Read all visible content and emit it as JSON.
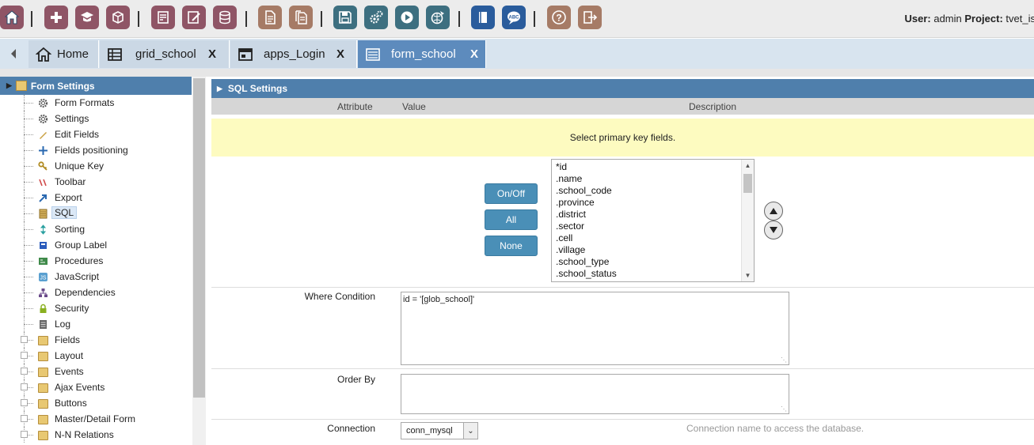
{
  "toolbar": {
    "user_label": "User:",
    "user_value": "admin",
    "project_label": "Project:",
    "project_value": "tvet_is",
    "icons": [
      "home-icon",
      "add-icon",
      "publish-icon",
      "cube-icon",
      "new-form-icon",
      "edit-form-icon",
      "database-icon",
      "document-icon",
      "documents-icon",
      "save-icon",
      "gears-icon",
      "run-icon",
      "deploy-icon",
      "book-icon",
      "spell-check-icon",
      "help-icon",
      "exit-icon"
    ]
  },
  "tabs": [
    {
      "label": "Home",
      "icon": "home-icon",
      "close": ""
    },
    {
      "label": "grid_school",
      "icon": "grid-icon",
      "close": "X"
    },
    {
      "label": "apps_Login",
      "icon": "control-icon",
      "close": "X"
    },
    {
      "label": "form_school",
      "icon": "form-icon",
      "close": "X"
    }
  ],
  "sidebar": {
    "title": "Form Settings",
    "items": [
      {
        "label": "Form Formats",
        "icon": "gear-icon",
        "type": "item"
      },
      {
        "label": "Settings",
        "icon": "gear-icon",
        "type": "item"
      },
      {
        "label": "Edit Fields",
        "icon": "pencil-icon",
        "type": "item"
      },
      {
        "label": "Fields positioning",
        "icon": "move-icon",
        "type": "item"
      },
      {
        "label": "Unique Key",
        "icon": "key-icon",
        "type": "item"
      },
      {
        "label": "Toolbar",
        "icon": "toolbar-icon",
        "type": "item"
      },
      {
        "label": "Export",
        "icon": "export-icon",
        "type": "item"
      },
      {
        "label": "SQL",
        "icon": "sql-icon",
        "type": "item",
        "selected": true
      },
      {
        "label": "Sorting",
        "icon": "sort-icon",
        "type": "item"
      },
      {
        "label": "Group Label",
        "icon": "group-icon",
        "type": "item"
      },
      {
        "label": "Procedures",
        "icon": "procedure-icon",
        "type": "item"
      },
      {
        "label": "JavaScript",
        "icon": "javascript-icon",
        "type": "item"
      },
      {
        "label": "Dependencies",
        "icon": "dependencies-icon",
        "type": "item"
      },
      {
        "label": "Security",
        "icon": "lock-icon",
        "type": "item"
      },
      {
        "label": "Log",
        "icon": "log-icon",
        "type": "item"
      },
      {
        "label": "Fields",
        "icon": "folder-icon",
        "type": "folder"
      },
      {
        "label": "Layout",
        "icon": "folder-icon",
        "type": "folder"
      },
      {
        "label": "Events",
        "icon": "folder-icon",
        "type": "folder"
      },
      {
        "label": "Ajax Events",
        "icon": "folder-icon",
        "type": "folder"
      },
      {
        "label": "Buttons",
        "icon": "folder-icon",
        "type": "folder"
      },
      {
        "label": "Master/Detail Form",
        "icon": "folder-icon",
        "type": "folder"
      },
      {
        "label": "N-N Relations",
        "icon": "folder-icon",
        "type": "folder"
      }
    ]
  },
  "main": {
    "title": "SQL Settings",
    "columns": {
      "attribute": "Attribute",
      "value": "Value",
      "description": "Description"
    },
    "notice": "Select primary key fields.",
    "buttons": {
      "onoff": "On/Off",
      "all": "All",
      "none": "None"
    },
    "fields": [
      "*id",
      ".name",
      ".school_code",
      ".province",
      ".district",
      ".sector",
      ".cell",
      ".village",
      ".school_type",
      ".school_status"
    ],
    "where_label": "Where Condition",
    "where_value": "id = '[glob_school]'",
    "orderby_label": "Order By",
    "orderby_value": "",
    "connection_label": "Connection",
    "connection_value": "conn_mysql",
    "connection_desc": "Connection name to access the database."
  }
}
